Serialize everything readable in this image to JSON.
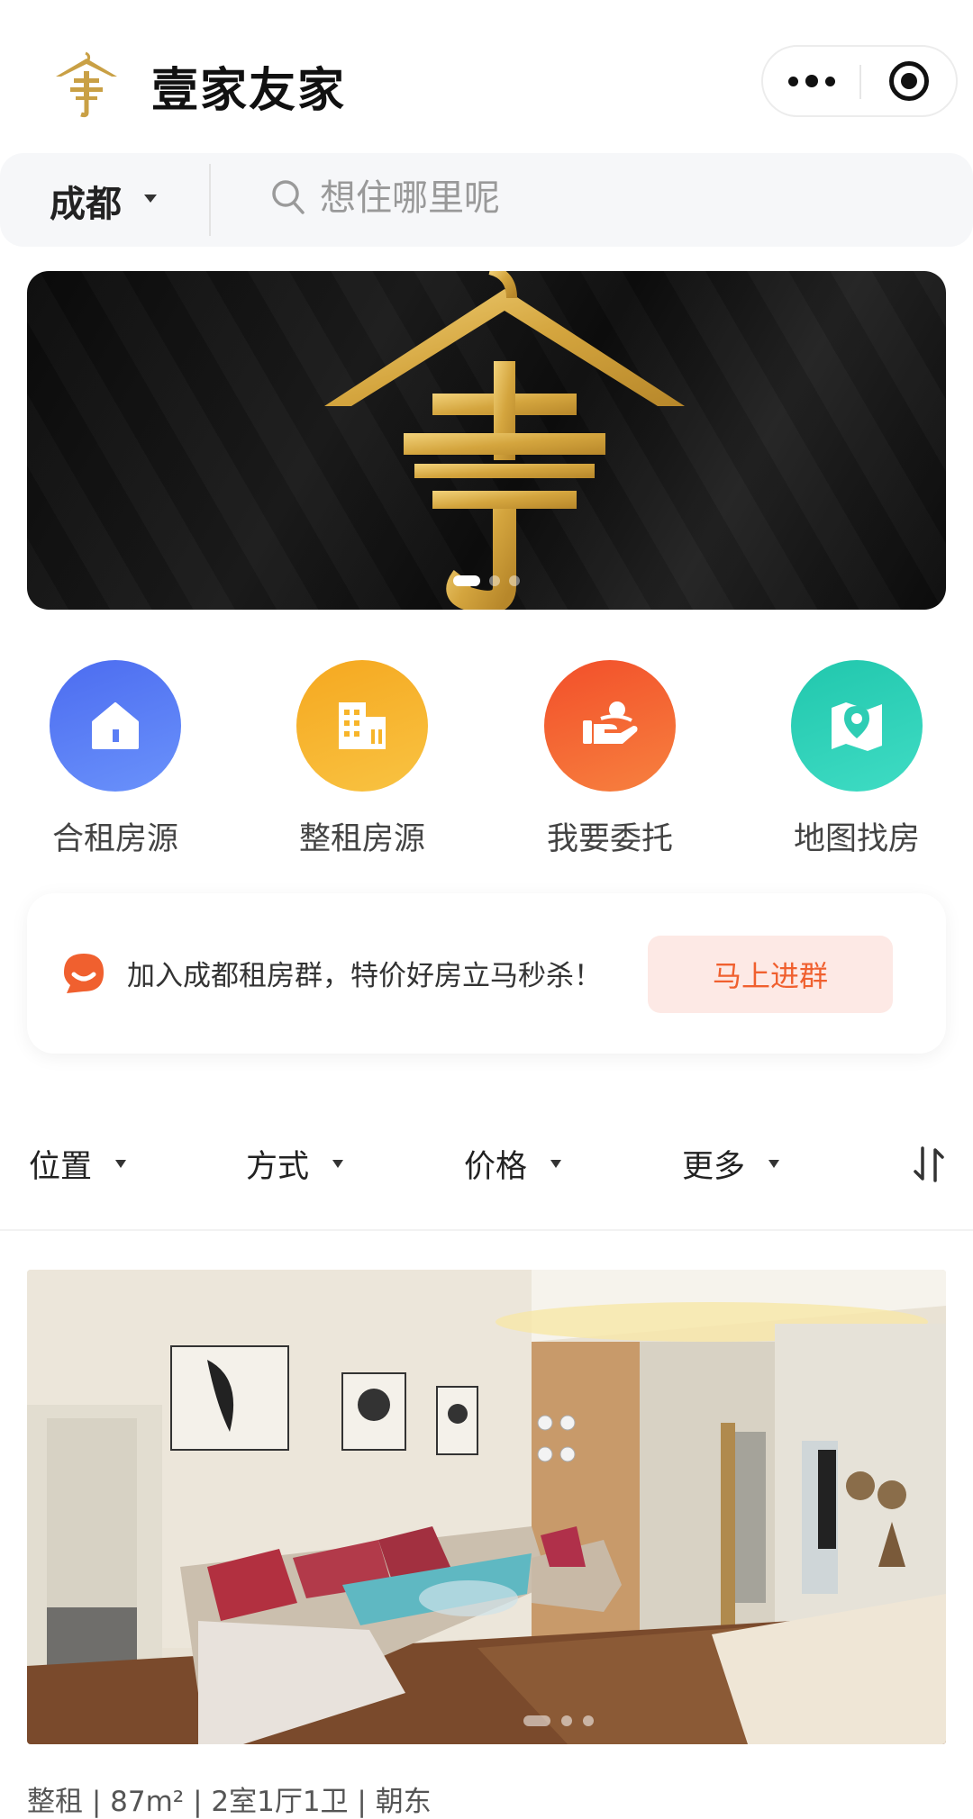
{
  "header": {
    "title": "壹家友家",
    "logo_icon": "brand-roof-logo-icon",
    "more_icon": "more-dots-icon",
    "close_icon": "close-target-icon"
  },
  "search": {
    "city": "成都",
    "placeholder": "想住哪里呢"
  },
  "banner": {
    "slide_count": 3,
    "active_index": 0
  },
  "quick_entries": [
    {
      "label": "合租房源",
      "icon": "house-icon",
      "color": "#5a7cf5"
    },
    {
      "label": "整租房源",
      "icon": "building-icon",
      "color": "#f7b52a"
    },
    {
      "label": "我要委托",
      "icon": "handshake-icon",
      "color": "#f5612e"
    },
    {
      "label": "地图找房",
      "icon": "map-pin-icon",
      "color": "#2ecdb4"
    }
  ],
  "group_promo": {
    "text": "加入成都租房群，特价好房立马秒杀！",
    "button": "马上进群"
  },
  "filters": [
    {
      "label": "位置"
    },
    {
      "label": "方式"
    },
    {
      "label": "价格"
    },
    {
      "label": "更多"
    }
  ],
  "listing": {
    "meta": "整租 | 87m² | 2室1厅1卫 | 朝东",
    "photo_count": 3,
    "active_photo": 0
  },
  "colors": {
    "accent_orange": "#f0602f",
    "gold": "#d6a83c"
  }
}
